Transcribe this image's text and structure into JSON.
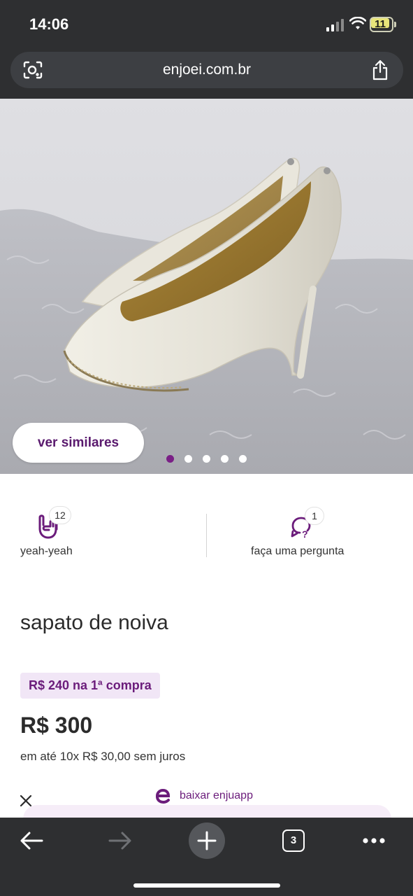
{
  "status_bar": {
    "time": "14:06",
    "battery": "11"
  },
  "browser": {
    "url": "enjoei.com.br",
    "tabs_count": "3"
  },
  "gallery": {
    "similar_button": "ver similares",
    "image_count": 5,
    "active_index": 0
  },
  "actions": {
    "like_label": "yeah-yeah",
    "like_count": "12",
    "question_label": "faça uma pergunta",
    "question_count": "1"
  },
  "product": {
    "title": "sapato de noiva",
    "promo": "R$ 240 na 1ª compra",
    "price": "R$ 300",
    "installments": "em até 10x R$ 30,00 sem juros"
  },
  "banner": {
    "app_label": "baixar enjuapp"
  },
  "colors": {
    "brand": "#6b1c7b",
    "chrome": "#2e2f31"
  }
}
